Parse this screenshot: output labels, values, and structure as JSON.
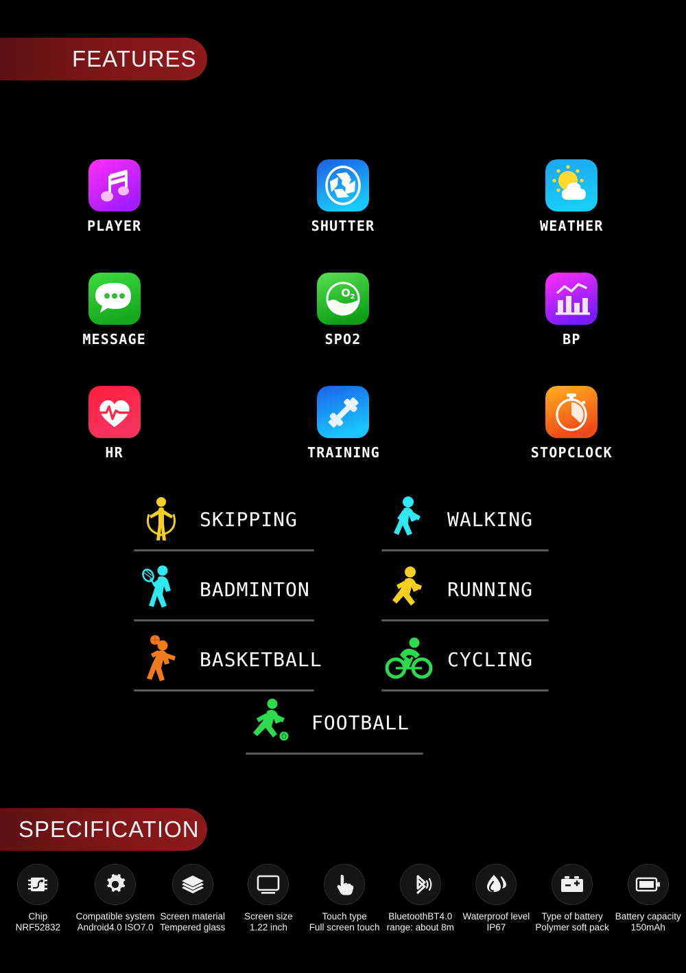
{
  "sections": {
    "features_banner": "FEATURES",
    "specification_banner": "SPECIFICATION"
  },
  "colors": {
    "background": "#000000",
    "banner_red": "#7a1616",
    "banner_text": "#fdf3f3",
    "label_text": "#ffffff",
    "divider": "#5a5a5a",
    "spec_circle": "#151515"
  },
  "apps": [
    [
      {
        "label": "PLAYER",
        "icon": "music-note-icon",
        "grad_from": "#ff2ff7",
        "grad_to": "#a21cff"
      },
      {
        "label": "SHUTTER",
        "icon": "camera-shutter-icon",
        "grad_from": "#1d5fe0",
        "grad_to": "#19c8ff"
      },
      {
        "label": "WEATHER",
        "icon": "sun-cloud-icon",
        "grad_from": "#1da6f0",
        "grad_to": "#19cdf5"
      }
    ],
    [
      {
        "label": "MESSAGE",
        "icon": "chat-bubble-icon",
        "grad_from": "#35d23a",
        "grad_to": "#18ab1e"
      },
      {
        "label": "SPO2",
        "icon": "oxygen-drop-icon",
        "grad_from": "#55e150",
        "grad_to": "#0fa018"
      },
      {
        "label": "BP",
        "icon": "bar-line-chart-icon",
        "grad_from": "#ff2ff7",
        "grad_to": "#7a1cff"
      }
    ],
    [
      {
        "label": "HR",
        "icon": "heartbeat-icon",
        "grad_from": "#ff1f3d",
        "grad_to": "#f5335e"
      },
      {
        "label": "TRAINING",
        "icon": "dumbbell-icon",
        "grad_from": "#1b62e8",
        "grad_to": "#19c6ff"
      },
      {
        "label": "STOPCLOCK",
        "icon": "stopwatch-icon",
        "grad_from": "#ffb020",
        "grad_to": "#f04a1a"
      }
    ]
  ],
  "sports": [
    {
      "label": "SKIPPING",
      "icon": "skipping-rope-figure-icon",
      "color": "#f5cf1f"
    },
    {
      "label": "WALKING",
      "icon": "walking-figure-icon",
      "color": "#2fe8f0"
    },
    {
      "label": "BADMINTON",
      "icon": "badminton-figure-icon",
      "color": "#2fe8f0"
    },
    {
      "label": "RUNNING",
      "icon": "running-figure-icon",
      "color": "#f5cf1f"
    },
    {
      "label": "BASKETBALL",
      "icon": "basketball-figure-icon",
      "color": "#f07a1e"
    },
    {
      "label": "CYCLING",
      "icon": "cycling-figure-icon",
      "color": "#2fd94f"
    },
    {
      "label": "FOOTBALL",
      "icon": "football-figure-icon",
      "color": "#2fd94f"
    }
  ],
  "specs": [
    {
      "icon": "chip-icon",
      "line1": "Chip",
      "line2": "NRF52832"
    },
    {
      "icon": "gear-icon",
      "line1": "Compatible system",
      "line2": "Android4.0 ISO7.0"
    },
    {
      "icon": "layers-icon",
      "line1": "Screen material",
      "line2": "Tempered glass"
    },
    {
      "icon": "monitor-icon",
      "line1": "Screen size",
      "line2": "1.22 inch"
    },
    {
      "icon": "hand-touch-icon",
      "line1": "Touch type",
      "line2": "Full screen touch"
    },
    {
      "icon": "bluetooth-icon",
      "line1": "BluetoothBT4.0",
      "line2": "range: about 8m"
    },
    {
      "icon": "water-drop-icon",
      "line1": "Waterproof level",
      "line2": "IP67"
    },
    {
      "icon": "battery-cell-icon",
      "line1": "Type of battery",
      "line2": "Polymer soft pack"
    },
    {
      "icon": "battery-full-icon",
      "line1": "Battery capacity",
      "line2": "150mAh"
    }
  ]
}
